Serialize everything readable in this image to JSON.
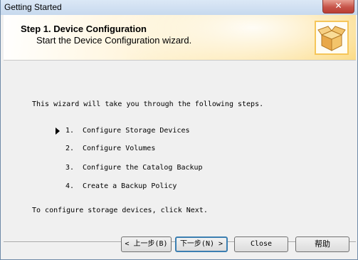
{
  "window": {
    "title": "Getting Started",
    "close_glyph": "✕"
  },
  "header": {
    "title": "Step 1.  Device Configuration",
    "subtitle": "Start the Device Configuration wizard.",
    "icon": "package-box-icon"
  },
  "content": {
    "intro": "This wizard will take you through the following steps.",
    "steps": [
      {
        "num": "1.",
        "label": "Configure Storage Devices",
        "current": true
      },
      {
        "num": "2.",
        "label": "Configure Volumes"
      },
      {
        "num": "3.",
        "label": "Configure the Catalog Backup"
      },
      {
        "num": "4.",
        "label": "Create a Backup Policy"
      }
    ],
    "instruction": "To configure storage devices, click Next."
  },
  "buttons": {
    "back": "< 上一步(B)",
    "next": "下一步(N) >",
    "close": "Close",
    "help": "帮助"
  }
}
